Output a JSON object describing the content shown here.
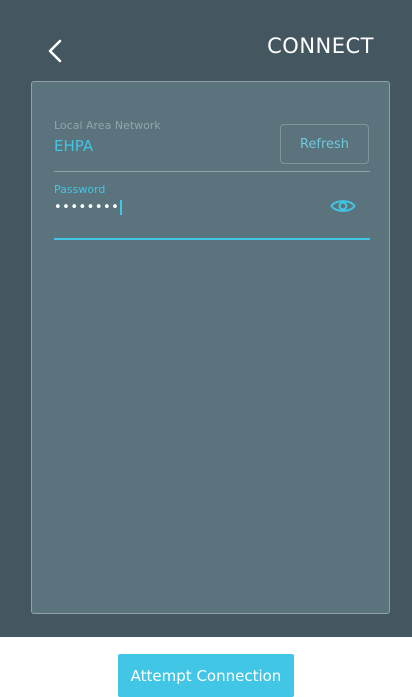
{
  "header": {
    "title": "CONNECT",
    "back_icon": "chevron-left-icon"
  },
  "form": {
    "network": {
      "label": "Local Area Network",
      "value": "EHPA",
      "refresh_label": "Refresh"
    },
    "password": {
      "label": "Password",
      "masked_value": "••••••••",
      "visibility_icon": "eye-icon"
    }
  },
  "footer": {
    "attempt_label": "Attempt Connection"
  },
  "colors": {
    "background": "#44565f",
    "panel": "#5b737c",
    "accent": "#41c6e6"
  }
}
